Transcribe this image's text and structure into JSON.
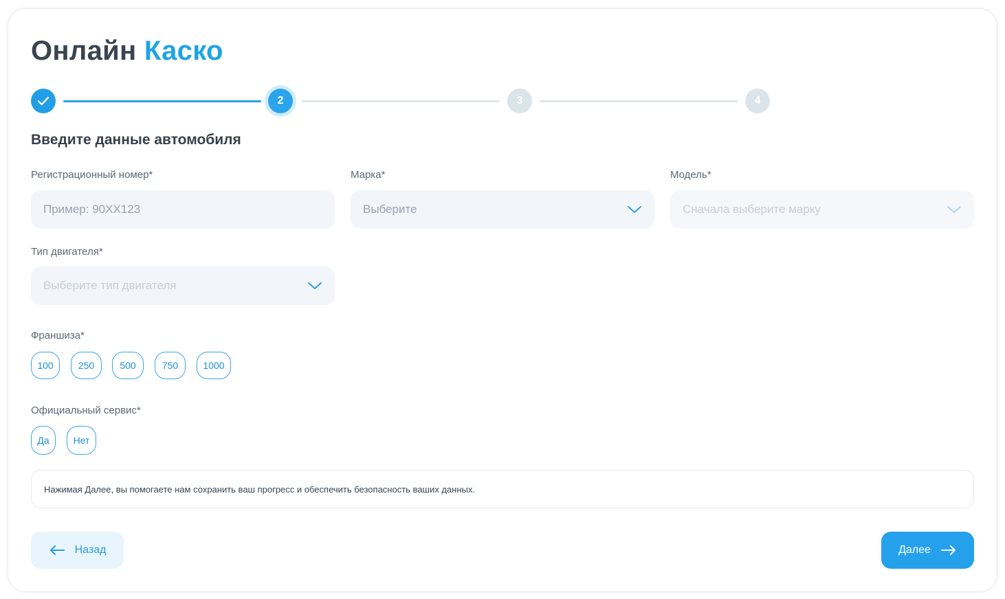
{
  "header": {
    "title_part1": "Онлайн",
    "title_part2": "Каско"
  },
  "stepper": {
    "steps": [
      {
        "label": "",
        "state": "done",
        "icon": "check-icon"
      },
      {
        "label": "2",
        "state": "current"
      },
      {
        "label": "3",
        "state": "pending"
      },
      {
        "label": "4",
        "state": "pending"
      }
    ]
  },
  "section": {
    "title": "Введите данные автомобиля"
  },
  "fields": {
    "reg_number": {
      "label": "Регистрационный номер*",
      "placeholder": "Пример: 90XX123",
      "value": ""
    },
    "brand": {
      "label": "Марка*",
      "placeholder": "Выберите",
      "icon": "chevron-down-icon"
    },
    "model": {
      "label": "Модель*",
      "placeholder": "Сначала выберите марку",
      "icon": "chevron-down-icon"
    },
    "engine": {
      "label": "Тип двигателя*",
      "placeholder": "Выберите тип двигателя",
      "icon": "chevron-down-icon"
    }
  },
  "franchise": {
    "label": "Франшиза*",
    "options": [
      "100",
      "250",
      "500",
      "750",
      "1000"
    ]
  },
  "official_service": {
    "label": "Официальный сервис*",
    "options": [
      "Да",
      "Нет"
    ]
  },
  "notice": {
    "text": "Нажимая Далее, вы помогаете нам сохранить ваш прогресс и обеспечить безопасность ваших данных."
  },
  "actions": {
    "back_label": "Назад",
    "back_icon": "arrow-left-icon",
    "next_label": "Далее",
    "next_icon": "arrow-right-icon"
  },
  "colors": {
    "accent": "#1ea4e6",
    "primary_button": "#25a1ec",
    "secondary_button": "#e8f5fd",
    "field_bg": "#f2f5f9",
    "pending_step": "#dbe3eb"
  }
}
